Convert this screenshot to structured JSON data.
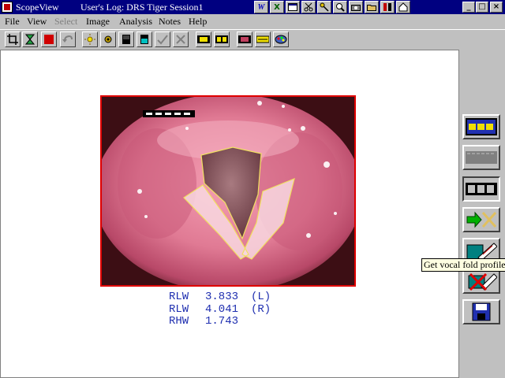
{
  "window": {
    "app_title": "ScopeView",
    "session_label": "User's Log:  DRS Tiger Session1",
    "title_icons": [
      "W",
      "X",
      "window-icon",
      "scissors-icon",
      "key-icon",
      "search-icon",
      "camera-icon",
      "folder-icon",
      "tools-icon",
      "home-icon"
    ],
    "controls": {
      "minimize": "_",
      "maximize": "□",
      "close": "×"
    }
  },
  "menu": [
    "File",
    "View",
    "Select",
    "Image",
    "Analysis",
    "Notes",
    "Help"
  ],
  "menu_disabled": [
    "Select"
  ],
  "toolbar_icons": [
    "crop-icon",
    "hourglass-icon",
    "stop-icon",
    "undo-icon",
    "sun-icon",
    "gear-sun-icon",
    "monitor-icon",
    "monitor-cyan-icon",
    "check-icon",
    "cancel-icon",
    "film-strip-icon",
    "film-frames-icon",
    "video-icon",
    "card-icon",
    "palette-icon"
  ],
  "measurements": [
    {
      "label": "RLW",
      "value": "3.833",
      "side": "(L)"
    },
    {
      "label": "RLW",
      "value": "4.041",
      "side": "(R)"
    },
    {
      "label": "RHW",
      "value": "1.743",
      "side": ""
    }
  ],
  "side_buttons": [
    "film-strip-blue-icon",
    "film-strip-gray-icon",
    "film-frame-icon",
    "next-cancel-icon",
    "vocal-fold-profile-icon",
    "delete-profile-icon",
    "save-icon"
  ],
  "tooltip": "Get vocal fold profile",
  "colors": {
    "titlebar": "#000080",
    "readout_text": "#1f2fb0",
    "image_border": "#e00000",
    "tissue": "#d86a86",
    "outline": "#f0e060"
  }
}
